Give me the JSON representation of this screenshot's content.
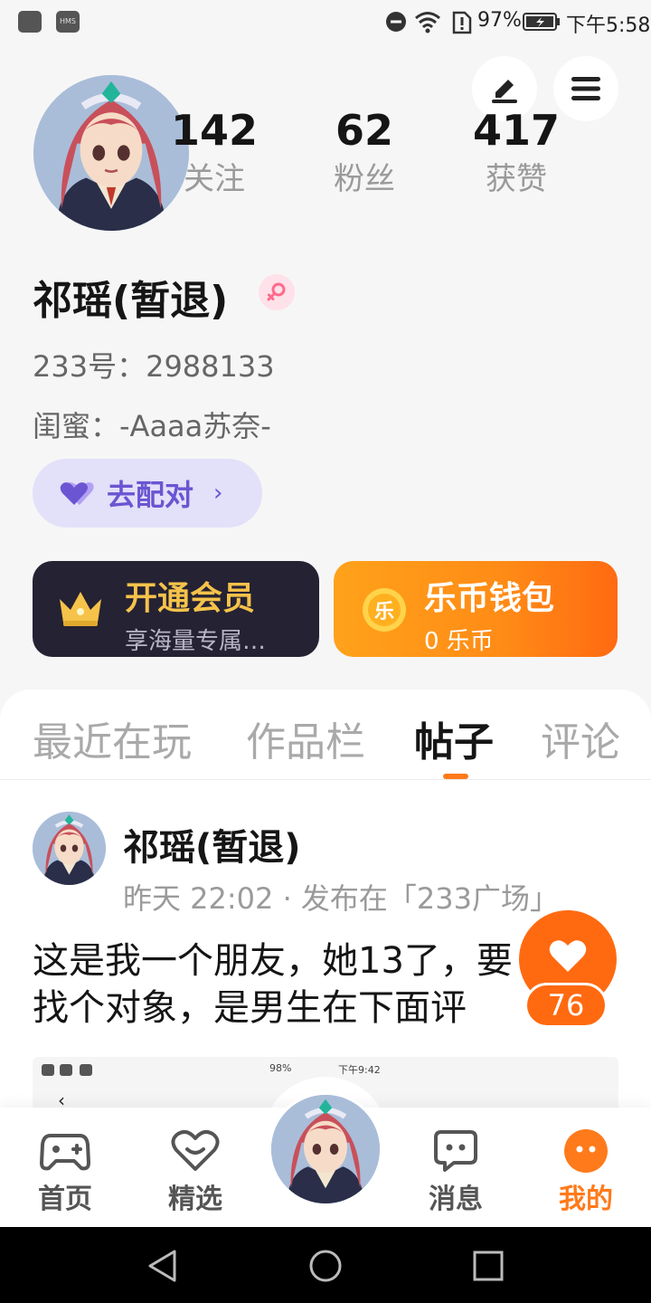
{
  "status_bar": {
    "battery": "97%",
    "time": "下午5:58",
    "hms": "HMS"
  },
  "profile": {
    "stats": [
      {
        "value": "142",
        "label": "关注"
      },
      {
        "value": "62",
        "label": "粉丝"
      },
      {
        "value": "417",
        "label": "获赞"
      }
    ],
    "name": "祁瑶(暂退)",
    "id_line": "233号：2988133",
    "bestie_line": "闺蜜：-Aaaa苏奈-",
    "pair_button": "去配对",
    "vip_card": {
      "title": "开通会员",
      "subtitle": "享海量专属…"
    },
    "wallet_card": {
      "title": "乐币钱包",
      "subtitle": "0 乐币",
      "coin_char": "乐"
    }
  },
  "tabs": [
    {
      "label": "最近在玩"
    },
    {
      "label": "作品栏"
    },
    {
      "label": "帖子"
    },
    {
      "label": "评论"
    }
  ],
  "active_tab": "帖子",
  "post": {
    "author": "祁瑶(暂退)",
    "meta": "昨天 22:02 · 发布在「233广场」",
    "text": "这是我一个朋友，她13了，要找个对象，是男生在下面评",
    "likes": "76",
    "thumb_status": {
      "battery": "98%",
      "time": "下午9:42",
      "back": "‹"
    }
  },
  "bottom_nav": [
    {
      "label": "首页"
    },
    {
      "label": "精选"
    },
    {
      "label": "消息"
    },
    {
      "label": "我的"
    }
  ],
  "colors": {
    "accent": "#ff7a1a",
    "purple": "#6b55d2",
    "vip_gold": "#f5c34a"
  }
}
